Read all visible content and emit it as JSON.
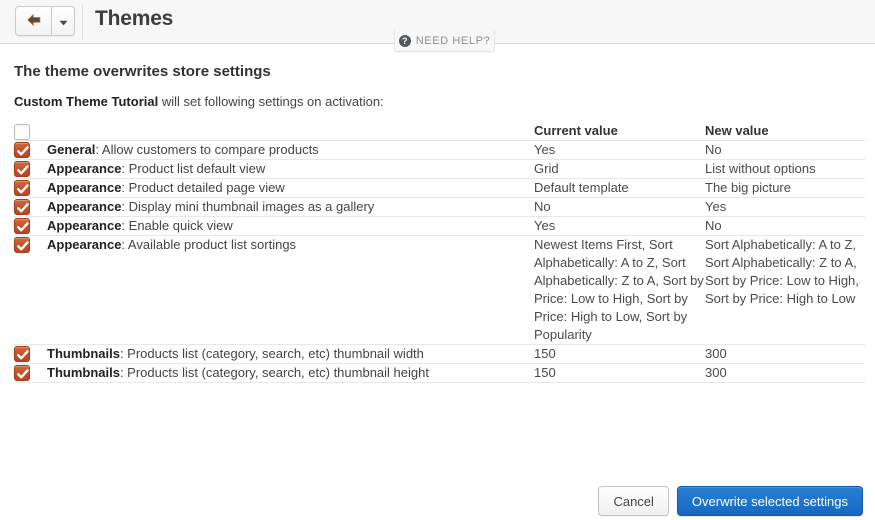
{
  "topbar": {
    "back_icon": "arrow-left-icon",
    "caret_icon": "caret-down-icon",
    "title": "Themes"
  },
  "need_help": {
    "icon": "question-mark-circle-icon",
    "icon_glyph": "?",
    "label": "NEED HELP?"
  },
  "content": {
    "heading": "The theme overwrites store settings",
    "sub_bold": "Custom Theme Tutorial",
    "sub_rest": " will set following settings on activation:"
  },
  "table": {
    "headers": {
      "select_all_checked": false,
      "current_value": "Current value",
      "new_value": "New value"
    },
    "rows": [
      {
        "checked": true,
        "group": "General",
        "setting": ": Allow customers to compare products",
        "current": "Yes",
        "new": "No"
      },
      {
        "checked": true,
        "group": "Appearance",
        "setting": ": Product list default view",
        "current": "Grid",
        "new": "List without options"
      },
      {
        "checked": true,
        "group": "Appearance",
        "setting": ": Product detailed page view",
        "current": "Default template",
        "new": "The big picture"
      },
      {
        "checked": true,
        "group": "Appearance",
        "setting": ": Display mini thumbnail images as a gallery",
        "current": "No",
        "new": "Yes"
      },
      {
        "checked": true,
        "group": "Appearance",
        "setting": ": Enable quick view",
        "current": "Yes",
        "new": "No"
      },
      {
        "checked": true,
        "group": "Appearance",
        "setting": ": Available product list sortings",
        "current": "Newest Items First, Sort Alphabetically: A to Z, Sort Alphabetically: Z to A, Sort by Price: Low to High, Sort by Price: High to Low, Sort by Popularity",
        "new": "Sort Alphabetically: A to Z, Sort Alphabetically: Z to A, Sort by Price: Low to High, Sort by Price: High to Low"
      },
      {
        "checked": true,
        "group": "Thumbnails",
        "setting": ": Products list (category, search, etc) thumbnail width",
        "current": "150",
        "new": "300"
      },
      {
        "checked": true,
        "group": "Thumbnails",
        "setting": ": Products list (category, search, etc) thumbnail height",
        "current": "150",
        "new": "300"
      }
    ]
  },
  "footer": {
    "cancel": "Cancel",
    "submit": "Overwrite selected settings"
  },
  "colors": {
    "checkbox_checked": "#c2522a",
    "primary_button": "#1668c0",
    "topbar_bg": "#f7f7f7",
    "row_border": "#e8e8e8"
  }
}
